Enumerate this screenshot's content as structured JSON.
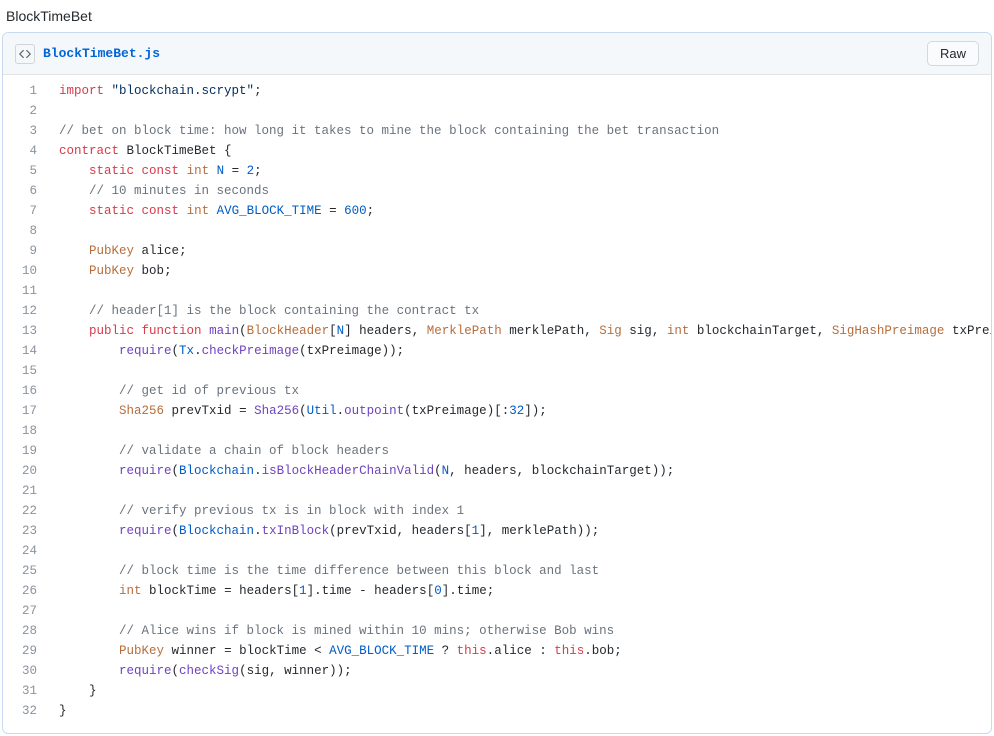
{
  "page": {
    "title": "BlockTimeBet"
  },
  "file": {
    "name": "BlockTimeBet.js",
    "raw_label": "Raw"
  },
  "code": {
    "lines": [
      [
        [
          "kw",
          "import"
        ],
        [
          "pun",
          " "
        ],
        [
          "str",
          "\"blockchain.scrypt\""
        ],
        [
          "pun",
          ";"
        ]
      ],
      [],
      [
        [
          "cmt",
          "// bet on block time: how long it takes to mine the block containing the bet transaction"
        ]
      ],
      [
        [
          "kw",
          "contract"
        ],
        [
          "pun",
          " "
        ],
        [
          "id",
          "BlockTimeBet"
        ],
        [
          "pun",
          " {"
        ]
      ],
      [
        [
          "pun",
          "    "
        ],
        [
          "kw",
          "static"
        ],
        [
          "pun",
          " "
        ],
        [
          "kw",
          "const"
        ],
        [
          "pun",
          " "
        ],
        [
          "type",
          "int"
        ],
        [
          "pun",
          " "
        ],
        [
          "const",
          "N"
        ],
        [
          "pun",
          " = "
        ],
        [
          "num",
          "2"
        ],
        [
          "pun",
          ";"
        ]
      ],
      [
        [
          "pun",
          "    "
        ],
        [
          "cmt",
          "// 10 minutes in seconds"
        ]
      ],
      [
        [
          "pun",
          "    "
        ],
        [
          "kw",
          "static"
        ],
        [
          "pun",
          " "
        ],
        [
          "kw",
          "const"
        ],
        [
          "pun",
          " "
        ],
        [
          "type",
          "int"
        ],
        [
          "pun",
          " "
        ],
        [
          "const",
          "AVG_BLOCK_TIME"
        ],
        [
          "pun",
          " = "
        ],
        [
          "num",
          "600"
        ],
        [
          "pun",
          ";"
        ]
      ],
      [],
      [
        [
          "pun",
          "    "
        ],
        [
          "type",
          "PubKey"
        ],
        [
          "pun",
          " "
        ],
        [
          "id",
          "alice"
        ],
        [
          "pun",
          ";"
        ]
      ],
      [
        [
          "pun",
          "    "
        ],
        [
          "type",
          "PubKey"
        ],
        [
          "pun",
          " "
        ],
        [
          "id",
          "bob"
        ],
        [
          "pun",
          ";"
        ]
      ],
      [],
      [
        [
          "pun",
          "    "
        ],
        [
          "cmt",
          "// header[1] is the block containing the contract tx"
        ]
      ],
      [
        [
          "pun",
          "    "
        ],
        [
          "kw",
          "public"
        ],
        [
          "pun",
          " "
        ],
        [
          "kw",
          "function"
        ],
        [
          "pun",
          " "
        ],
        [
          "fn",
          "main"
        ],
        [
          "pun",
          "("
        ],
        [
          "type",
          "BlockHeader"
        ],
        [
          "pun",
          "["
        ],
        [
          "const",
          "N"
        ],
        [
          "pun",
          "] "
        ],
        [
          "id",
          "headers"
        ],
        [
          "pun",
          ", "
        ],
        [
          "type",
          "MerklePath"
        ],
        [
          "pun",
          " "
        ],
        [
          "id",
          "merklePath"
        ],
        [
          "pun",
          ", "
        ],
        [
          "type",
          "Sig"
        ],
        [
          "pun",
          " "
        ],
        [
          "id",
          "sig"
        ],
        [
          "pun",
          ", "
        ],
        [
          "type",
          "int"
        ],
        [
          "pun",
          " "
        ],
        [
          "id",
          "blockchainTarget"
        ],
        [
          "pun",
          ", "
        ],
        [
          "type",
          "SigHashPreimage"
        ],
        [
          "pun",
          " "
        ],
        [
          "id",
          "txPreimage"
        ],
        [
          "pun",
          ") {"
        ]
      ],
      [
        [
          "pun",
          "        "
        ],
        [
          "fn",
          "require"
        ],
        [
          "pun",
          "("
        ],
        [
          "const",
          "Tx"
        ],
        [
          "pun",
          "."
        ],
        [
          "fn",
          "checkPreimage"
        ],
        [
          "pun",
          "("
        ],
        [
          "id",
          "txPreimage"
        ],
        [
          "pun",
          "));"
        ]
      ],
      [],
      [
        [
          "pun",
          "        "
        ],
        [
          "cmt",
          "// get id of previous tx"
        ]
      ],
      [
        [
          "pun",
          "        "
        ],
        [
          "type",
          "Sha256"
        ],
        [
          "pun",
          " "
        ],
        [
          "id",
          "prevTxid"
        ],
        [
          "pun",
          " = "
        ],
        [
          "fn",
          "Sha256"
        ],
        [
          "pun",
          "("
        ],
        [
          "const",
          "Util"
        ],
        [
          "pun",
          "."
        ],
        [
          "fn",
          "outpoint"
        ],
        [
          "pun",
          "("
        ],
        [
          "id",
          "txPreimage"
        ],
        [
          "pun",
          ")[:"
        ],
        [
          "num",
          "32"
        ],
        [
          "pun",
          "]);"
        ]
      ],
      [],
      [
        [
          "pun",
          "        "
        ],
        [
          "cmt",
          "// validate a chain of block headers"
        ]
      ],
      [
        [
          "pun",
          "        "
        ],
        [
          "fn",
          "require"
        ],
        [
          "pun",
          "("
        ],
        [
          "const",
          "Blockchain"
        ],
        [
          "pun",
          "."
        ],
        [
          "fn",
          "isBlockHeaderChainValid"
        ],
        [
          "pun",
          "("
        ],
        [
          "const",
          "N"
        ],
        [
          "pun",
          ", "
        ],
        [
          "id",
          "headers"
        ],
        [
          "pun",
          ", "
        ],
        [
          "id",
          "blockchainTarget"
        ],
        [
          "pun",
          "));"
        ]
      ],
      [],
      [
        [
          "pun",
          "        "
        ],
        [
          "cmt",
          "// verify previous tx is in block with index 1"
        ]
      ],
      [
        [
          "pun",
          "        "
        ],
        [
          "fn",
          "require"
        ],
        [
          "pun",
          "("
        ],
        [
          "const",
          "Blockchain"
        ],
        [
          "pun",
          "."
        ],
        [
          "fn",
          "txInBlock"
        ],
        [
          "pun",
          "("
        ],
        [
          "id",
          "prevTxid"
        ],
        [
          "pun",
          ", "
        ],
        [
          "id",
          "headers"
        ],
        [
          "pun",
          "["
        ],
        [
          "num",
          "1"
        ],
        [
          "pun",
          "], "
        ],
        [
          "id",
          "merklePath"
        ],
        [
          "pun",
          "));"
        ]
      ],
      [],
      [
        [
          "pun",
          "        "
        ],
        [
          "cmt",
          "// block time is the time difference between this block and last"
        ]
      ],
      [
        [
          "pun",
          "        "
        ],
        [
          "type",
          "int"
        ],
        [
          "pun",
          " "
        ],
        [
          "id",
          "blockTime"
        ],
        [
          "pun",
          " = "
        ],
        [
          "id",
          "headers"
        ],
        [
          "pun",
          "["
        ],
        [
          "num",
          "1"
        ],
        [
          "pun",
          "]."
        ],
        [
          "id",
          "time"
        ],
        [
          "pun",
          " - "
        ],
        [
          "id",
          "headers"
        ],
        [
          "pun",
          "["
        ],
        [
          "num",
          "0"
        ],
        [
          "pun",
          "]."
        ],
        [
          "id",
          "time"
        ],
        [
          "pun",
          ";"
        ]
      ],
      [],
      [
        [
          "pun",
          "        "
        ],
        [
          "cmt",
          "// Alice wins if block is mined within 10 mins; otherwise Bob wins"
        ]
      ],
      [
        [
          "pun",
          "        "
        ],
        [
          "type",
          "PubKey"
        ],
        [
          "pun",
          " "
        ],
        [
          "id",
          "winner"
        ],
        [
          "pun",
          " = "
        ],
        [
          "id",
          "blockTime"
        ],
        [
          "pun",
          " < "
        ],
        [
          "const",
          "AVG_BLOCK_TIME"
        ],
        [
          "pun",
          " ? "
        ],
        [
          "kw",
          "this"
        ],
        [
          "pun",
          "."
        ],
        [
          "id",
          "alice"
        ],
        [
          "pun",
          " : "
        ],
        [
          "kw",
          "this"
        ],
        [
          "pun",
          "."
        ],
        [
          "id",
          "bob"
        ],
        [
          "pun",
          ";"
        ]
      ],
      [
        [
          "pun",
          "        "
        ],
        [
          "fn",
          "require"
        ],
        [
          "pun",
          "("
        ],
        [
          "fn",
          "checkSig"
        ],
        [
          "pun",
          "("
        ],
        [
          "id",
          "sig"
        ],
        [
          "pun",
          ", "
        ],
        [
          "id",
          "winner"
        ],
        [
          "pun",
          "));"
        ]
      ],
      [
        [
          "pun",
          "    }"
        ]
      ],
      [
        [
          "pun",
          "}"
        ]
      ]
    ]
  }
}
